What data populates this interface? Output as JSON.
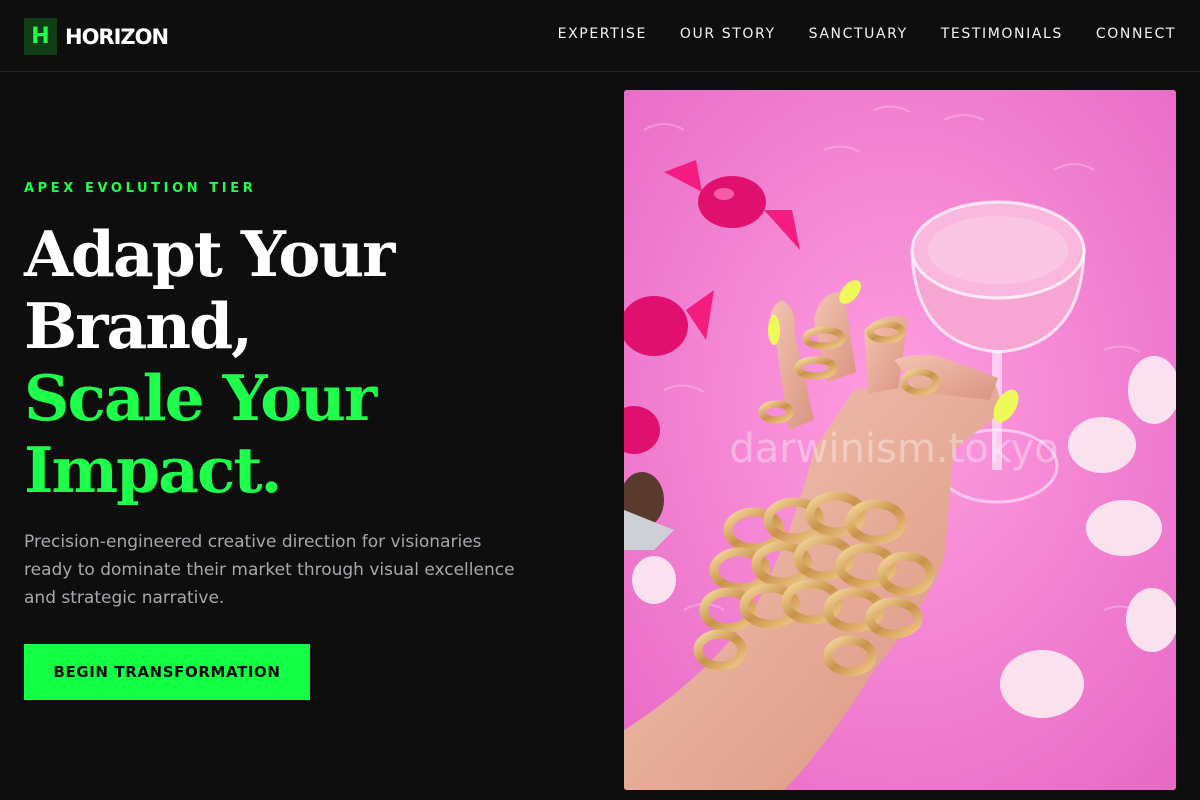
{
  "brand": {
    "mark": "H",
    "name": "HORIZON",
    "accent": "#1DFF4A"
  },
  "nav": {
    "items": [
      {
        "label": "EXPERTISE"
      },
      {
        "label": "OUR STORY"
      },
      {
        "label": "SANCTUARY"
      },
      {
        "label": "TESTIMONIALS"
      },
      {
        "label": "CONNECT"
      }
    ]
  },
  "hero": {
    "eyebrow": "APEX EVOLUTION TIER",
    "headline": {
      "line1": "Adapt Your",
      "line2": "Brand,",
      "line3": "Scale Your",
      "line4": "Impact."
    },
    "lede": "Precision-engineered creative direction for visionaries ready to dominate their market through visual excellence and strategic narrative.",
    "cta_label": "BEGIN TRANSFORMATION",
    "image": {
      "watermark": "darwinism.tokyo"
    }
  },
  "colors": {
    "background": "#0E0E0E",
    "accent_green": "#1DFF4A",
    "muted_text": "#A7A7AD",
    "image_pink": "#F27CCF"
  }
}
